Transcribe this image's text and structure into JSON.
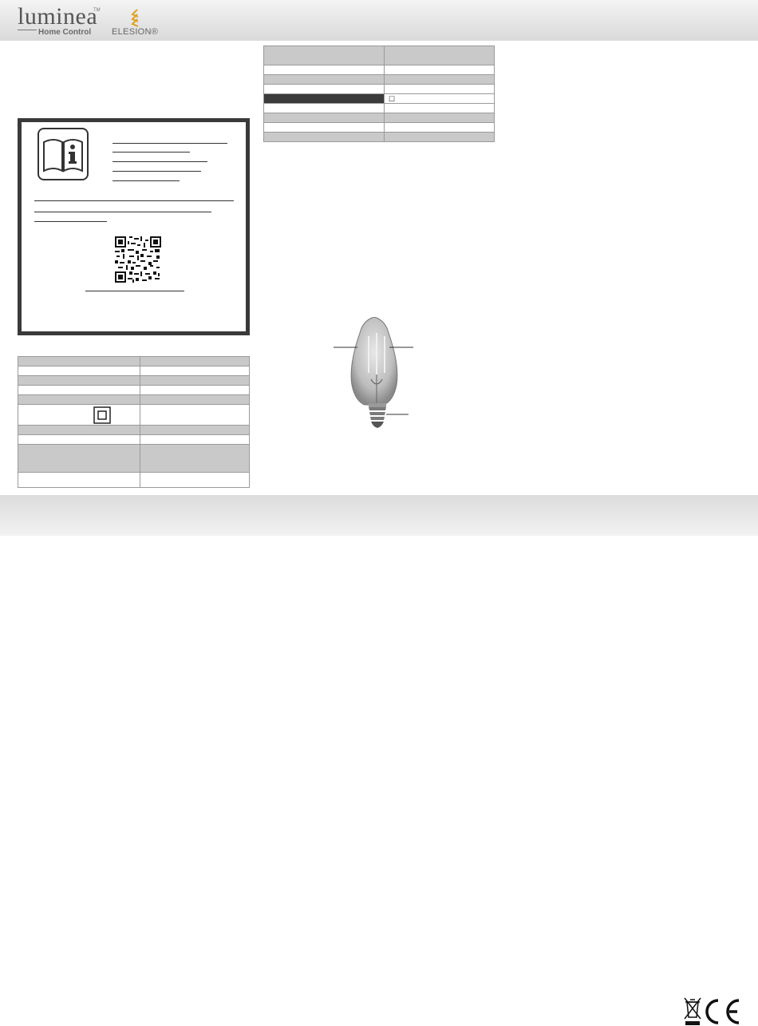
{
  "header": {
    "brand_logo_text": "luminea",
    "brand_logo_sub": "Home Control",
    "brand_logo_tm": "TM",
    "partner_logo_text": "ELESION®"
  },
  "notice": {
    "icon": "manual-info-icon"
  },
  "tables": {
    "left_rows": 10,
    "right_rows": 10,
    "right_row4_symbol": "☐"
  },
  "footer": {
    "marks": [
      "weee-bin-icon",
      "ce-mark"
    ]
  },
  "colors": {
    "header_bg": "#dcdcdc",
    "table_gray": "#c9c9c9",
    "table_dark": "#3b3b3b",
    "border_dark": "#3a3a3a"
  }
}
